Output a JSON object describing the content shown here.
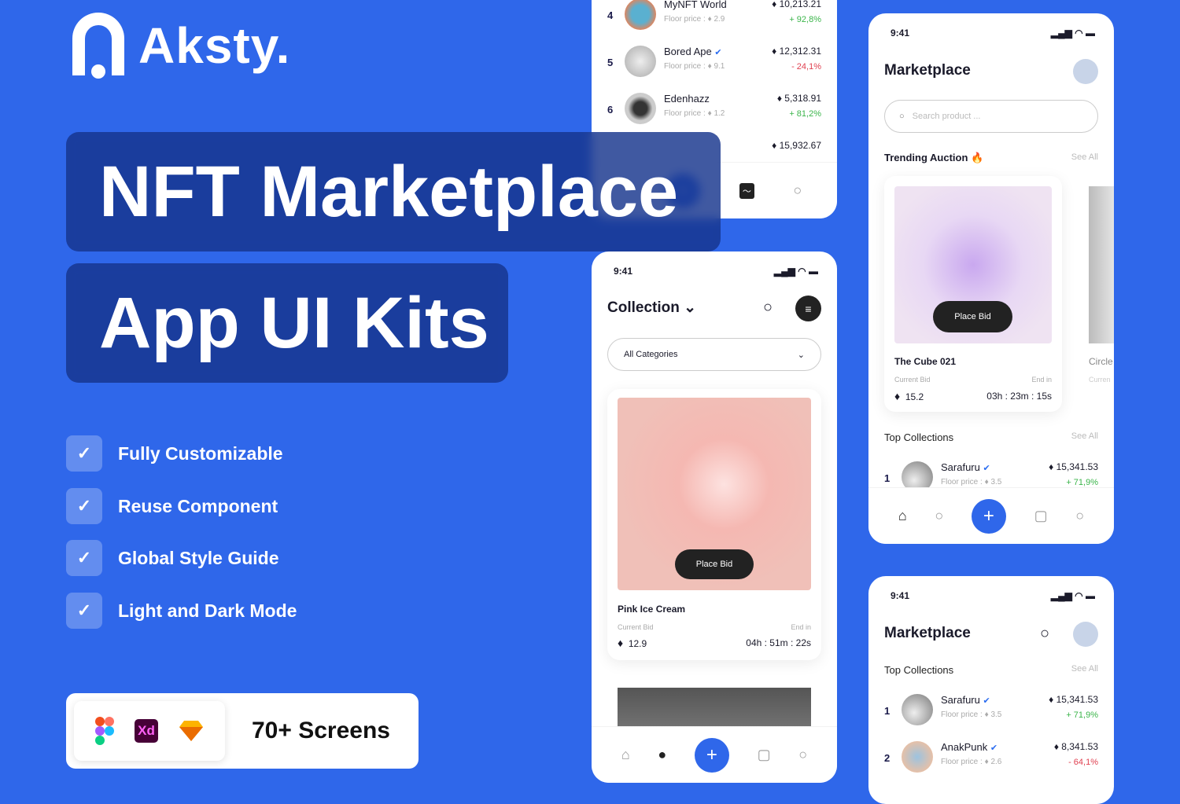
{
  "brand": {
    "name": "Aksty."
  },
  "headline": {
    "line1": "NFT Marketplace",
    "line2": "App UI Kits"
  },
  "features": [
    "Fully Customizable",
    "Reuse Component",
    "Global Style Guide",
    "Light and Dark Mode"
  ],
  "tools": {
    "icons": [
      "figma-icon",
      "adobe-xd-icon",
      "sketch-icon"
    ],
    "xd_label": "Xd",
    "screens": "70+ Screens"
  },
  "colors": {
    "background": "#2f67ea",
    "accent": "#2f67ea",
    "positive": "#3bb54a",
    "negative": "#e04050"
  },
  "ranking_phone": {
    "rows": [
      {
        "rank": "4",
        "name": "MyNFT World",
        "floor_label": "Floor price :",
        "floor": "2.9",
        "price": "10,213.21",
        "change": "+ 92,8%",
        "dir": "up"
      },
      {
        "rank": "5",
        "name": "Bored Ape",
        "verified": true,
        "floor_label": "Floor price :",
        "floor": "9.1",
        "price": "12,312.31",
        "change": "- 24,1%",
        "dir": "dn"
      },
      {
        "rank": "6",
        "name": "Edenhazz",
        "floor_label": "Floor price :",
        "floor": "1.2",
        "price": "5,318.91",
        "change": "+ 81,2%",
        "dir": "up"
      },
      {
        "price": "15,932.67"
      }
    ]
  },
  "collection_phone": {
    "time": "9:41",
    "title": "Collection",
    "category": "All Categories",
    "card": {
      "title": "Pink Ice Cream",
      "place_bid": "Place Bid",
      "current_bid_label": "Current Bid",
      "bid": "12.9",
      "end_label": "End in",
      "end": "04h : 51m : 22s"
    }
  },
  "market_phone": {
    "time": "9:41",
    "title": "Marketplace",
    "search_placeholder": "Search product ...",
    "trending": "Trending Auction",
    "see_all": "See All",
    "card": {
      "title": "The Cube 021",
      "place_bid": "Place Bid",
      "current_bid_label": "Current Bid",
      "bid": "15.2",
      "end_label": "End in",
      "end": "03h : 23m : 15s"
    },
    "next_card": {
      "title": "Circle",
      "current_bid_label": "Curren"
    },
    "top_collections": "Top Collections",
    "rows": [
      {
        "rank": "1",
        "name": "Sarafuru",
        "floor_label": "Floor price :",
        "floor": "3.5",
        "price": "15,341.53",
        "change": "+ 71,9%"
      }
    ]
  },
  "market_phone2": {
    "time": "9:41",
    "title": "Marketplace",
    "top_collections": "Top Collections",
    "see_all": "See All",
    "rows": [
      {
        "rank": "1",
        "name": "Sarafuru",
        "floor_label": "Floor price :",
        "floor": "3.5",
        "price": "15,341.53",
        "change": "+ 71,9%",
        "dir": "up"
      },
      {
        "rank": "2",
        "name": "AnakPunk",
        "floor_label": "Floor price :",
        "floor": "2.6",
        "price": "8,341.53",
        "change": "- 64,1%",
        "dir": "dn"
      }
    ]
  }
}
